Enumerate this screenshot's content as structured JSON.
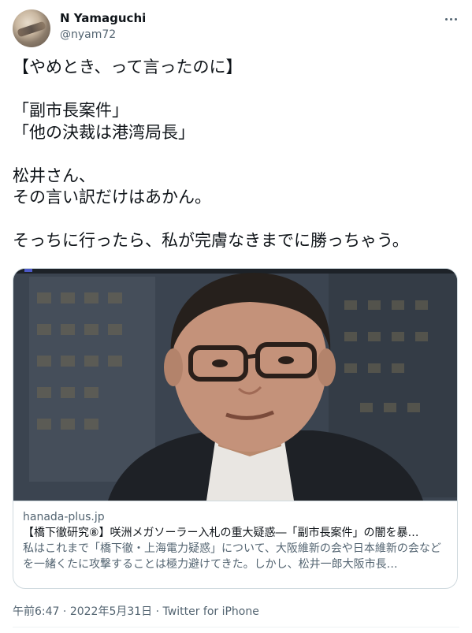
{
  "author": {
    "display_name": "N Yamaguchi",
    "handle": "@nyam72"
  },
  "tweet": {
    "text": "【やめとき、って言ったのに】\n\n「副市長案件」\n「他の決裁は港湾局長」\n\n松井さん、\nその言い訳だけはあかん。\n\nそっちに行ったら、私が完膚なきまでに勝っちゃう。"
  },
  "card": {
    "domain": "hanada-plus.jp",
    "title": "【橋下徹研究⑧】咲洲メガソーラー入札の重大疑惑―「副市長案件」の闇を暴…",
    "description": "私はこれまで「橋下徹・上海電力疑惑」について、大阪維新の会や日本維新の会などを一緒くたに攻撃することは極力避けてきた。しかし、松井一郎大阪市長…",
    "image_icon": "news-photo"
  },
  "meta": {
    "time": "午前6:47",
    "separator1": " · ",
    "date": "2022年5月31日",
    "separator2": " · ",
    "source": "Twitter for iPhone"
  },
  "colors": {
    "text_primary": "#0f1419",
    "text_secondary": "#536471",
    "border": "#cfd9de"
  }
}
